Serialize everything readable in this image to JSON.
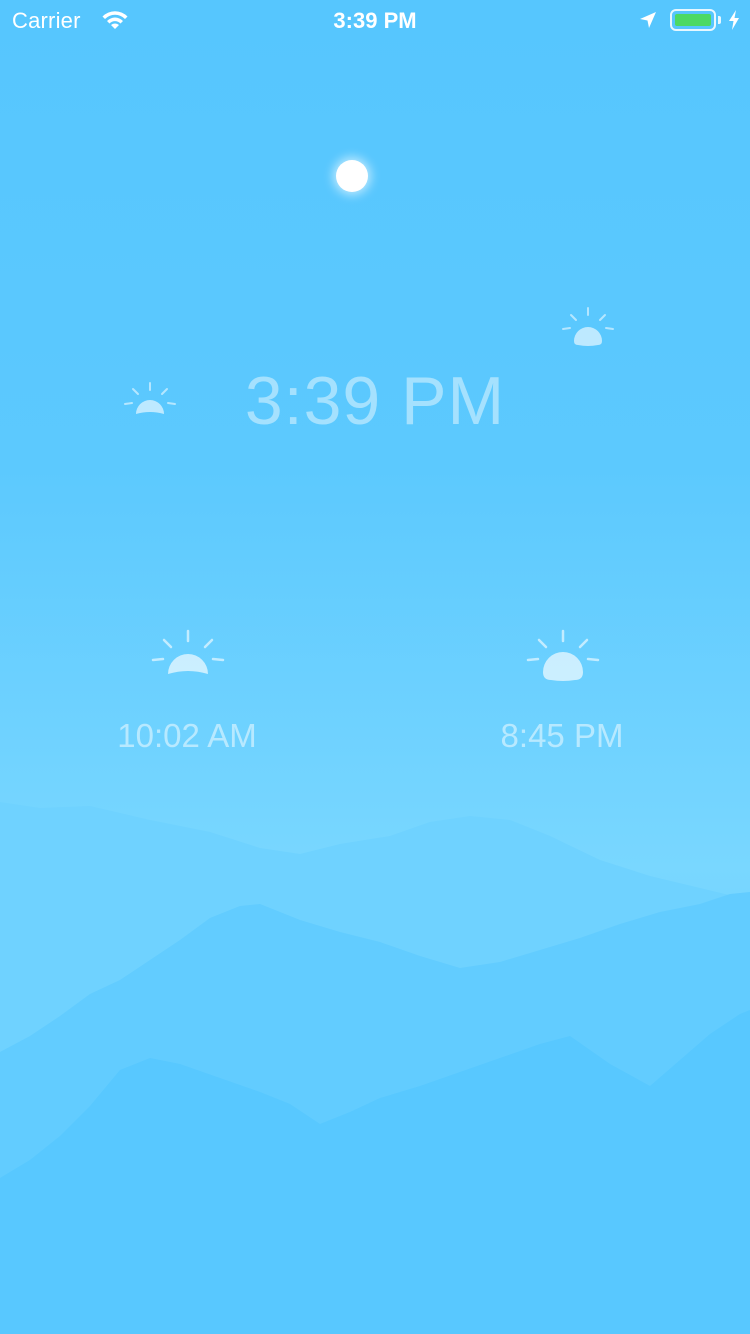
{
  "status_bar": {
    "carrier": "Carrier",
    "time": "3:39 PM",
    "battery_color": "#4cd964"
  },
  "main": {
    "current_time": "3:39 PM",
    "sunrise_time": "10:02 AM",
    "sunset_time": "8:45 PM"
  },
  "icons": {
    "wifi": "wifi-icon",
    "location": "location-arrow-icon",
    "charging": "bolt-icon",
    "sun_indicator": "sun-dot",
    "sunrise": "sunrise-icon",
    "sunset": "sunset-icon"
  },
  "colors": {
    "sky_top": "#56c6fe",
    "sky_mid": "#79d7ff",
    "mountain_far": "#6fd2ff",
    "mountain_mid": "#62ccff",
    "mountain_near": "#55c6ff"
  }
}
